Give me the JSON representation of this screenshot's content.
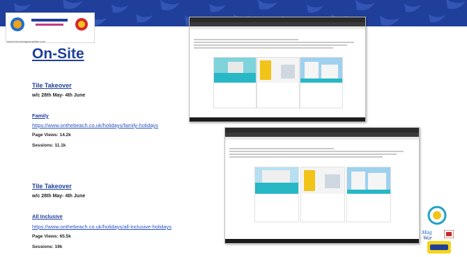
{
  "page": {
    "title": "On-Site"
  },
  "logo": {
    "url": "www.introducingcanastian.com"
  },
  "sections": [
    {
      "heading": "Tile Takeover",
      "dates": "w/c 28th May- 4th June",
      "category": "Family",
      "url": "https://www.onthebeach.co.uk/holidays/family-holidays",
      "page_views": "Page Views: 14.2k",
      "sessions": "Sessions: 11.1k"
    },
    {
      "heading": "Tile Takeover",
      "dates": "w/c 28th May- 4th June",
      "category": "All Inclusive",
      "url": "https://www.onthebeach.co.uk/holidays/all-inclusive-holidays",
      "page_views": "Page Views: 65.5k",
      "sessions": "Sessions: 19k"
    }
  ],
  "colors": {
    "brand_blue": "#1f3f9a",
    "link_blue": "#2a52be",
    "pool_teal": "#28b7c4",
    "sun_yellow": "#f2c318"
  },
  "icons": [
    "mediterranean-attitude-logo",
    "introducing-salou-logo",
    "costa-dorada-logo",
    "magic-world-logo",
    "on-the-beach-logo"
  ]
}
